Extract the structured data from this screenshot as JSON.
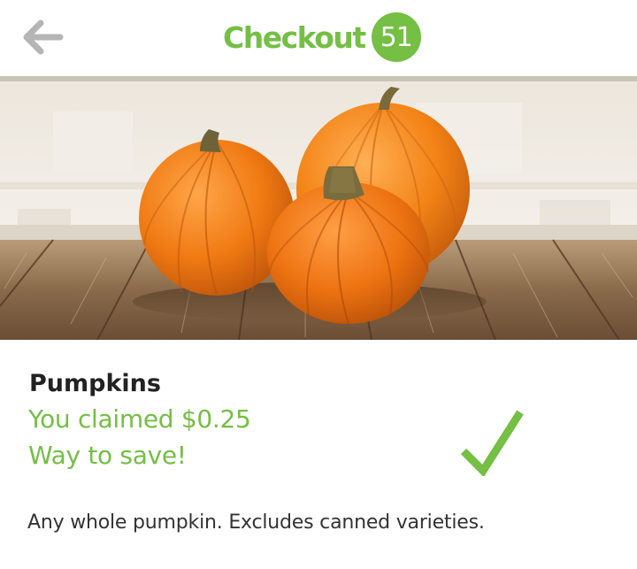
{
  "header": {
    "back_icon": "arrow-left-icon",
    "logo_text": "Checkout",
    "logo_number": "51"
  },
  "hero": {
    "image": "pumpkins-on-wooden-table"
  },
  "offer": {
    "title": "Pumpkins",
    "claimed_text": "You claimed $0.25",
    "message": "Way to save!",
    "status_icon": "checkmark-icon",
    "description": "Any whole pumpkin. Excludes canned varieties."
  },
  "colors": {
    "brand_green": "#74bf44",
    "back_arrow": "#b5b5b5",
    "title_text": "#222222"
  }
}
